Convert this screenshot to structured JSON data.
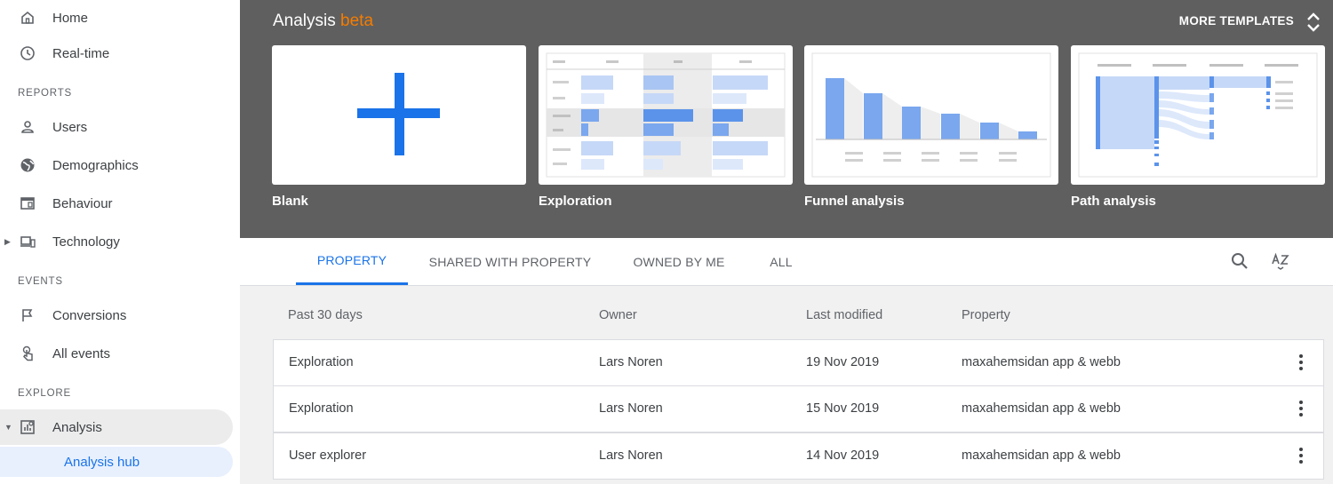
{
  "sidebar": {
    "home": "Home",
    "realtime": "Real-time",
    "reports_section": "REPORTS",
    "users": "Users",
    "demographics": "Demographics",
    "behaviour": "Behaviour",
    "technology": "Technology",
    "events_section": "EVENTS",
    "conversions": "Conversions",
    "all_events": "All events",
    "explore_section": "EXPLORE",
    "analysis": "Analysis",
    "analysis_hub": "Analysis hub"
  },
  "header": {
    "title": "Analysis",
    "title_badge": "beta",
    "more_templates": "MORE TEMPLATES",
    "templates": [
      "Blank",
      "Exploration",
      "Funnel analysis",
      "Path analysis"
    ]
  },
  "tabs": [
    "PROPERTY",
    "SHARED WITH PROPERTY",
    "OWNED BY ME",
    "ALL"
  ],
  "active_tab": "PROPERTY",
  "table": {
    "columns": [
      "Past 30 days",
      "Owner",
      "Last modified",
      "Property"
    ],
    "rows": [
      [
        "Exploration",
        "Lars Noren",
        "19 Nov 2019",
        "maxahemsidan app & webb"
      ],
      [
        "Exploration",
        "Lars Noren",
        "15 Nov 2019",
        "maxahemsidan app & webb"
      ],
      [
        "User explorer",
        "Lars Noren",
        "14 Nov 2019",
        "maxahemsidan app & webb"
      ]
    ]
  },
  "colors": {
    "accent": "#1a73e8",
    "beta": "#f57c00",
    "header_bg": "#5f5f5f",
    "active_nav_bg": "#e8f0fe"
  }
}
